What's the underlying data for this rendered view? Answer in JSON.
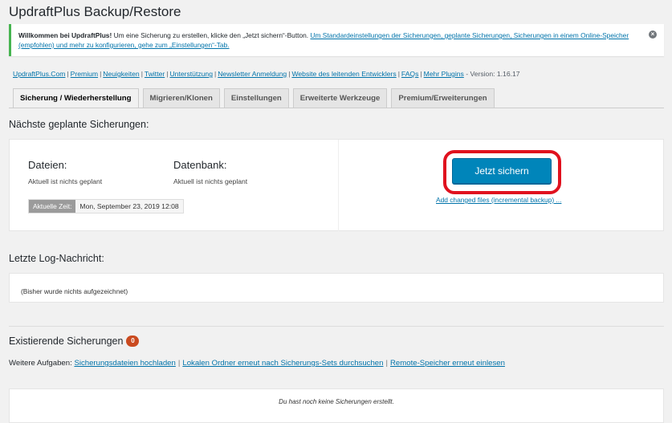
{
  "page": {
    "title": "UpdraftPlus Backup/Restore"
  },
  "notice": {
    "welcome": "Willkommen bei UpdraftPlus!",
    "text": "Um eine Sicherung zu erstellen, klicke den „Jetzt sichern“-Button.",
    "link": "Um Standardeinstellungen der Sicherungen, geplante Sicherungen, Sicherungen in einem Online-Speicher (empfohlen) und mehr zu konfigurieren, gehe zum „Einstellungen“-Tab.",
    "close_icon": "×"
  },
  "links": {
    "items": [
      "UpdraftPlus.Com",
      "Premium",
      "Neuigkeiten",
      "Twitter",
      "Unterstützung",
      "Newsletter Anmeldung",
      "Website des leitenden Entwicklers",
      "FAQs",
      "Mehr Plugins"
    ],
    "separator": "|",
    "version": "- Version: 1.16.17"
  },
  "tabs": [
    {
      "label": "Sicherung / Wiederherstellung",
      "active": true
    },
    {
      "label": "Migrieren/Klonen",
      "active": false
    },
    {
      "label": "Einstellungen",
      "active": false
    },
    {
      "label": "Erweiterte Werkzeuge",
      "active": false
    },
    {
      "label": "Premium/Erweiterungen",
      "active": false
    }
  ],
  "scheduled": {
    "heading": "Nächste geplante Sicherungen:",
    "files_label": "Dateien:",
    "files_status": "Aktuell ist nichts geplant",
    "db_label": "Datenbank:",
    "db_status": "Aktuell ist nichts geplant",
    "time_label": "Aktuelle Zeit:",
    "time_value": "Mon, September 23, 2019 12:08",
    "backup_button": "Jetzt sichern",
    "incremental_link": "Add changed files (incremental backup) ..."
  },
  "log": {
    "heading": "Letzte Log-Nachricht:",
    "message": "(Bisher wurde nichts aufgezeichnet)"
  },
  "existing": {
    "heading": "Existierende Sicherungen",
    "count": "0",
    "tasks_label": "Weitere Aufgaben:",
    "task_links": [
      "Sicherungsdateien hochladen",
      "Lokalen Ordner erneut nach Sicherungs-Sets durchsuchen",
      "Remote-Speicher erneut einlesen"
    ],
    "empty_message": "Du hast noch keine Sicherungen erstellt."
  },
  "colors": {
    "accent": "#0085ba",
    "highlight": "#e0111e",
    "notice_border": "#46b450",
    "badge": "#ca4a1f"
  }
}
